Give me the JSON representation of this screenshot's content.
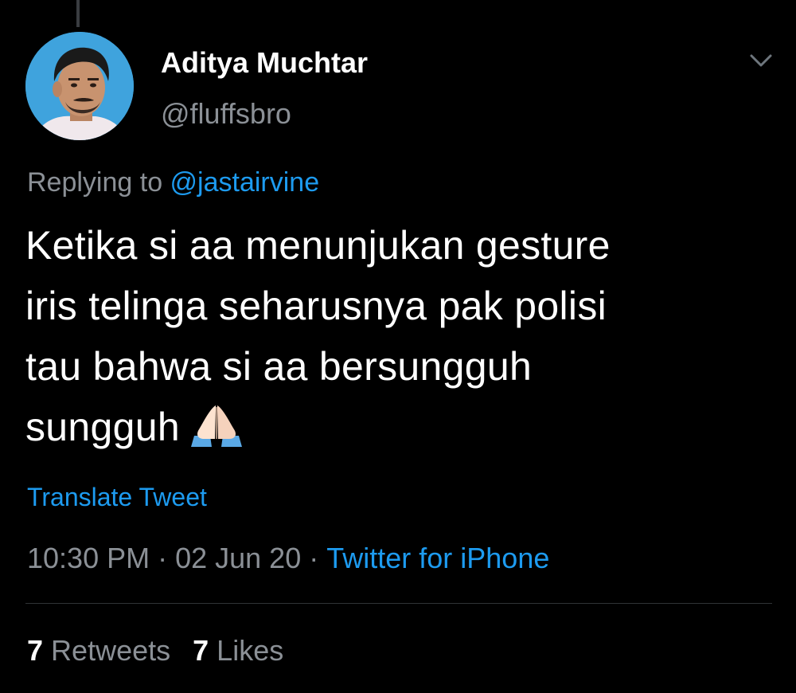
{
  "tweet": {
    "author": {
      "name": "Aditya Muchtar",
      "handle": "@fluffsbro"
    },
    "reply": {
      "prefix": "Replying to ",
      "mention": "@jastairvine"
    },
    "text_lines": [
      "Ketika si aa menunjukan gesture",
      "iris telinga seharusnya pak polisi",
      "tau bahwa si aa bersungguh",
      "sungguh"
    ],
    "emoji": "folded-hands",
    "translate_label": "Translate Tweet",
    "time": "10:30 PM",
    "separator": "·",
    "date": "02 Jun 20",
    "source": "Twitter for iPhone",
    "stats": {
      "retweets_count": "7",
      "retweets_label": "Retweets",
      "likes_count": "7",
      "likes_label": "Likes"
    }
  },
  "icons": {
    "menu": "chevron-down-icon",
    "emoji": "folded-hands-icon"
  },
  "colors": {
    "background": "#000000",
    "text": "#ffffff",
    "secondary_text": "#8b9096",
    "accent": "#1d9bf0",
    "divider": "#2f3336",
    "avatar_bg": "#3fa3dd"
  }
}
